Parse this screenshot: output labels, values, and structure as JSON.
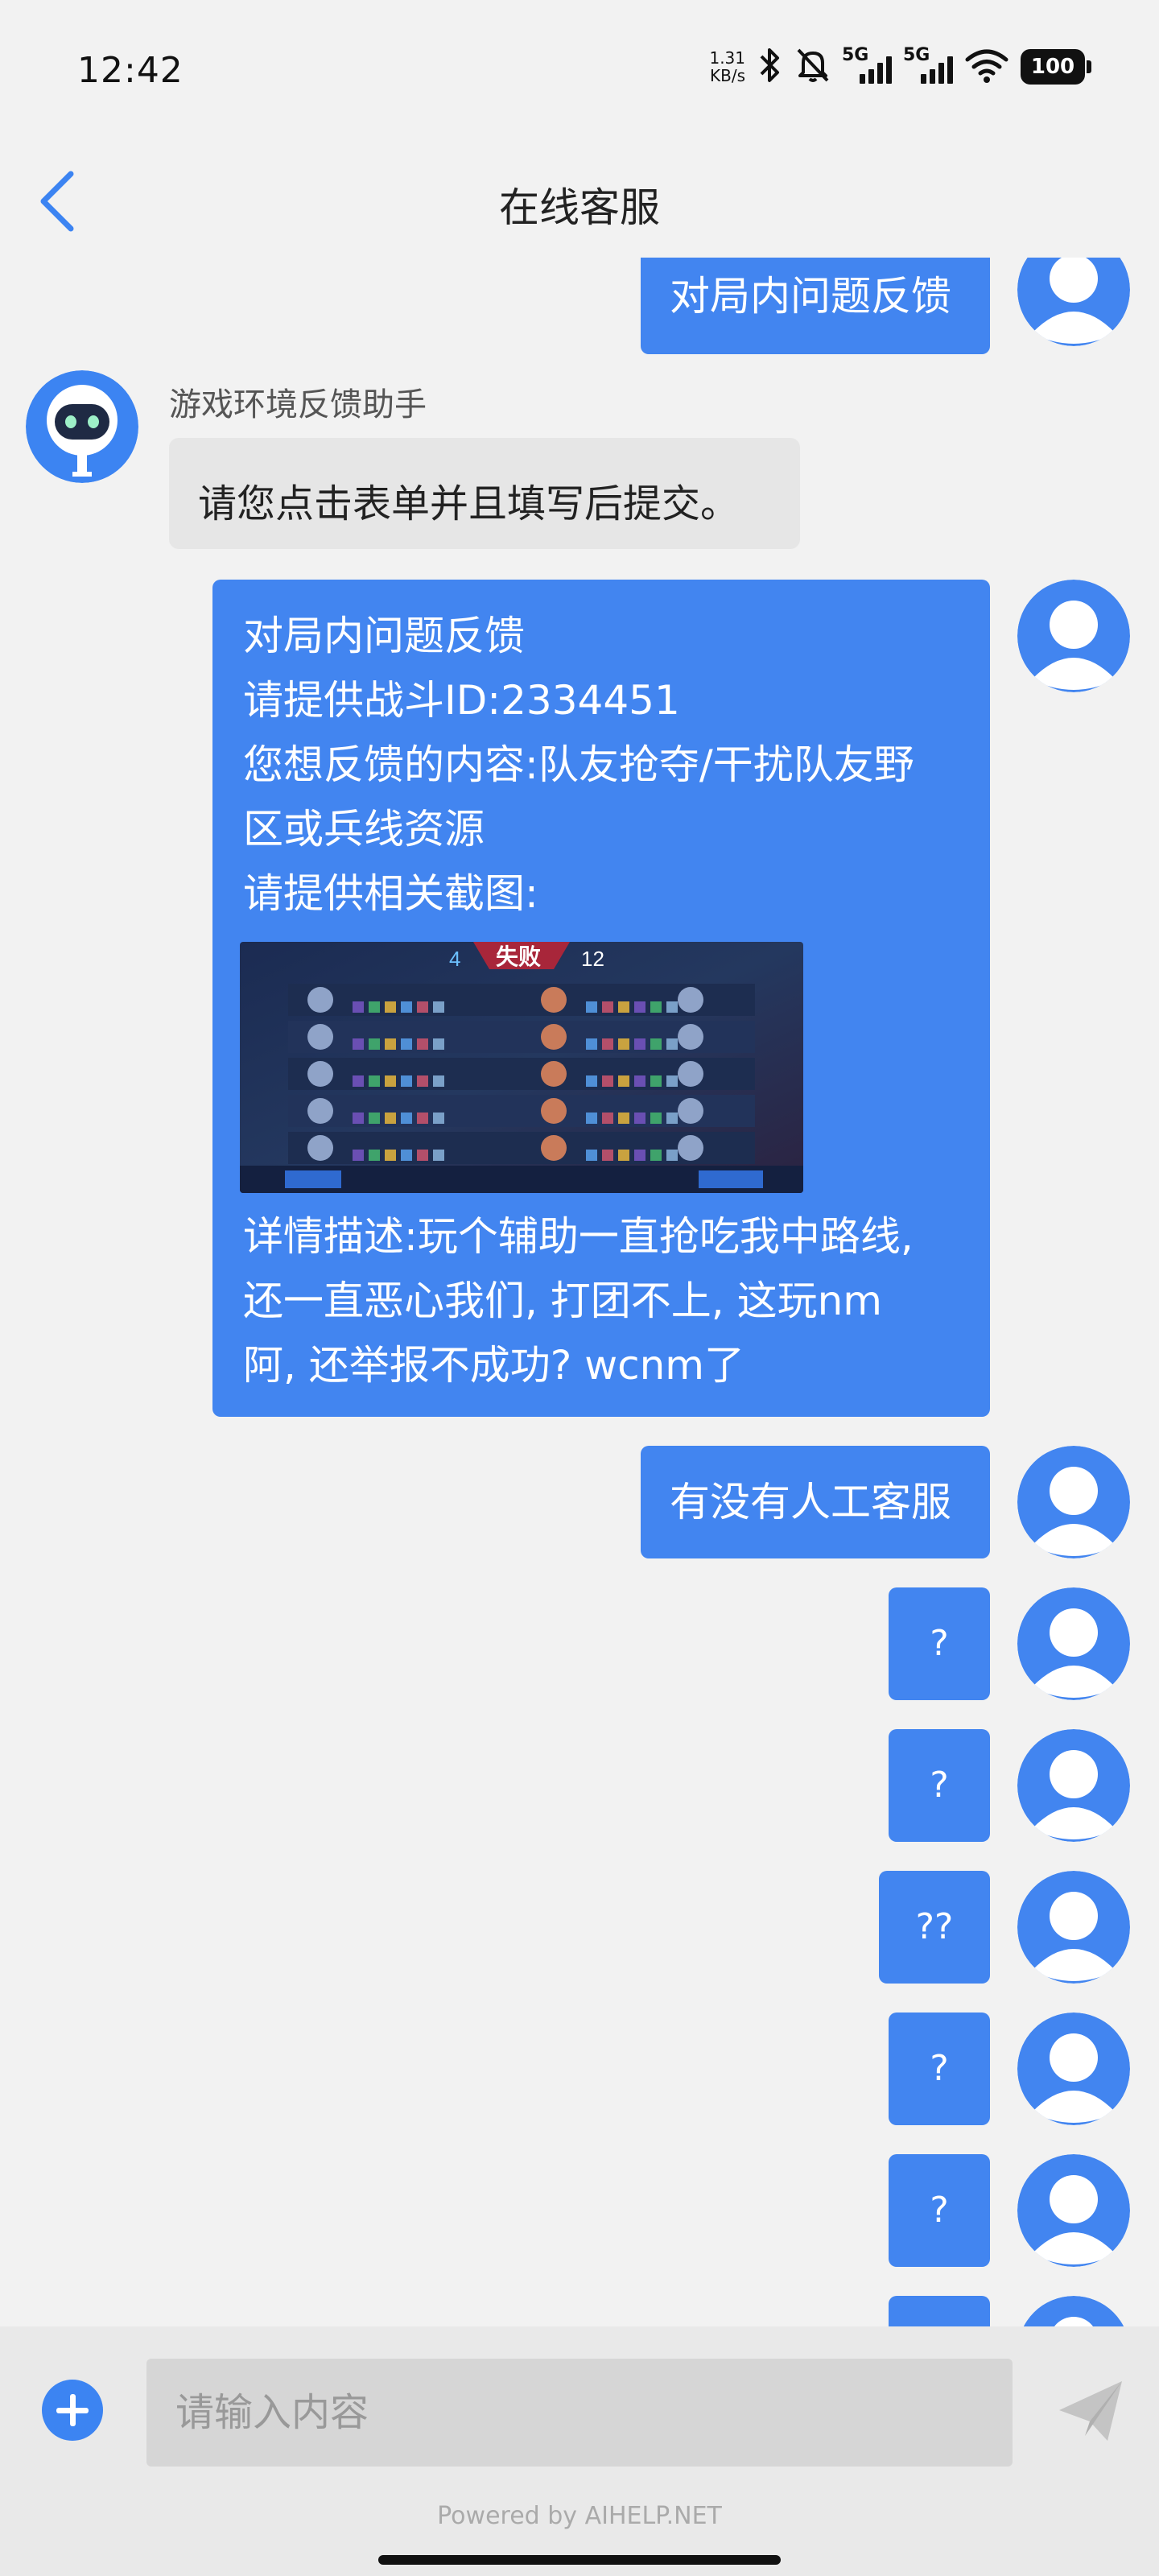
{
  "status_bar": {
    "time": "12:42",
    "net_speed_value": "1.31",
    "net_speed_unit": "KB/s",
    "sim1_label": "5G",
    "sim2_label": "5G",
    "battery": "100"
  },
  "header": {
    "title": "在线客服"
  },
  "bot": {
    "name": "游戏环境反馈助手"
  },
  "messages": {
    "out_top": "对局内问题反馈",
    "bot_reply": "请您点击表单并且填写后提交。",
    "form": {
      "line1": "对局内问题反馈",
      "line2": "请提供战斗ID:2334451",
      "line3": "您想反馈的内容:队友抢夺/干扰队友野",
      "line4": "区或兵线资源",
      "line5": "请提供相关截图:",
      "line6": "详情描述:玩个辅助一直抢吃我中路线,",
      "line7": "还一直恶心我们, 打团不上, 这玩nm",
      "line8": "阿, 还举报不成功? wcnm了"
    },
    "screenshot": {
      "score_left": "4",
      "result": "失败",
      "score_right": "12"
    },
    "human_agent": "有没有人工客服",
    "q1": "?",
    "q2": "?",
    "q3": "??",
    "q4": "?",
    "q5": "?"
  },
  "input": {
    "placeholder": "请输入内容"
  },
  "footer": {
    "powered_by": "Powered by AIHELP.NET"
  },
  "colors": {
    "bubble_out": "#4285f0",
    "bubble_in": "#e6e6e6",
    "accent": "#3c84f2"
  }
}
